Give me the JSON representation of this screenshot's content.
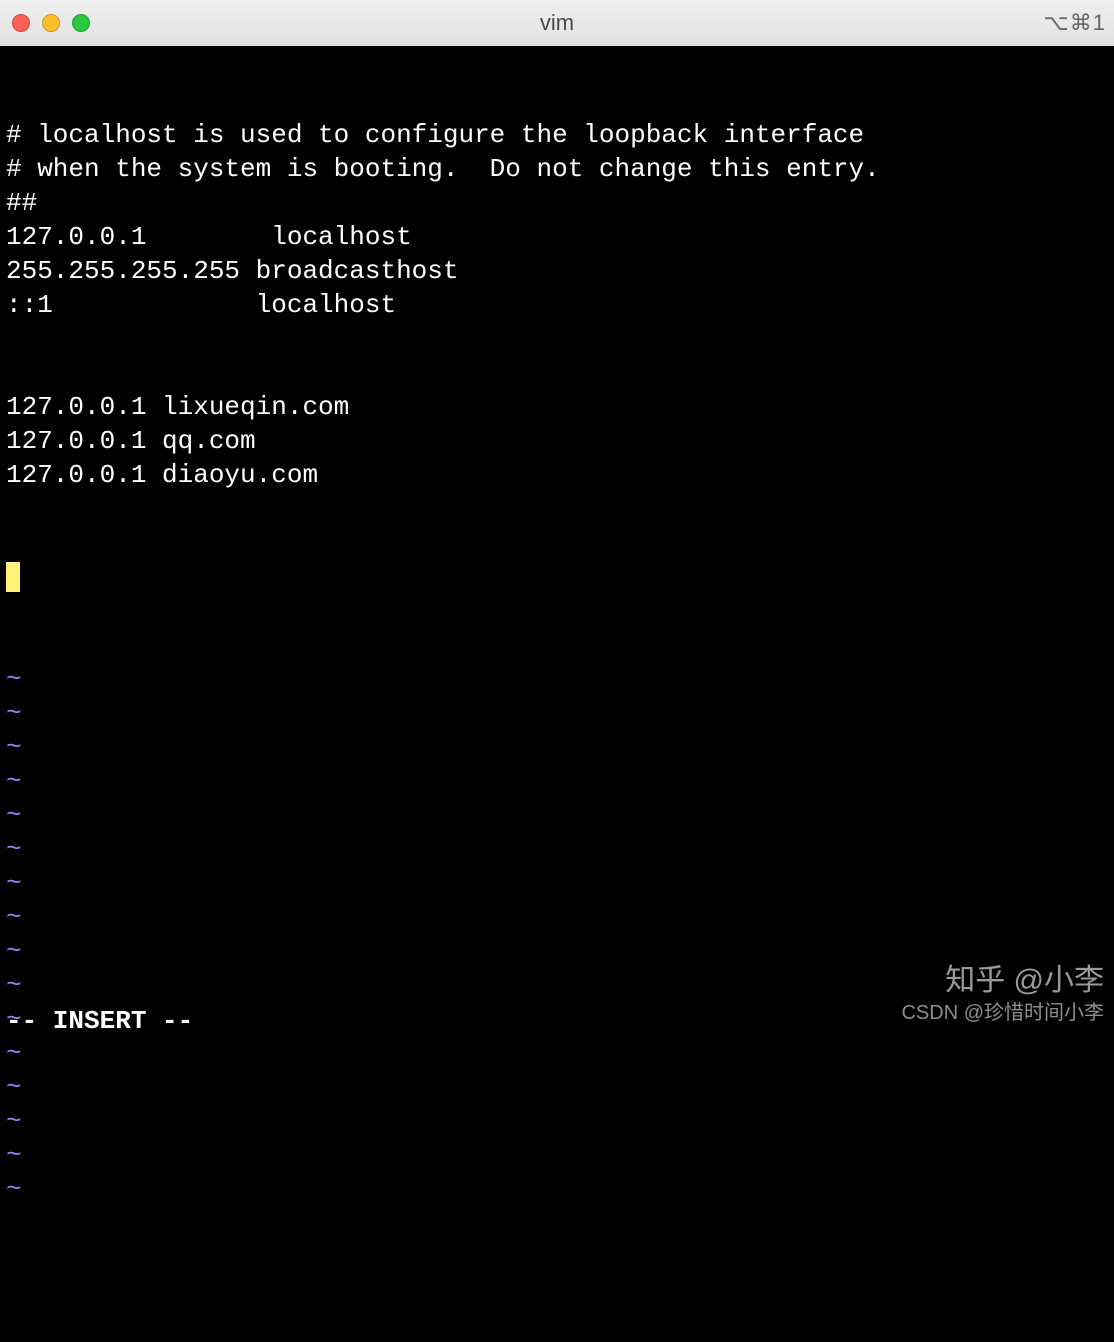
{
  "titlebar": {
    "title": "vim",
    "right_indicator": "⌥⌘1"
  },
  "editor": {
    "lines": [
      "# localhost is used to configure the loopback interface",
      "# when the system is booting.  Do not change this entry.",
      "##",
      "127.0.0.1        localhost",
      "255.255.255.255 broadcasthost",
      "::1             localhost",
      "",
      "",
      "127.0.0.1 lixueqin.com",
      "127.0.0.1 qq.com",
      "127.0.0.1 diaoyu.com"
    ],
    "tilde": "~",
    "tilde_count": 16,
    "status": "-- INSERT --"
  },
  "watermark": {
    "top": "知乎 @小李",
    "bottom": "CSDN @珍惜时间小李"
  }
}
